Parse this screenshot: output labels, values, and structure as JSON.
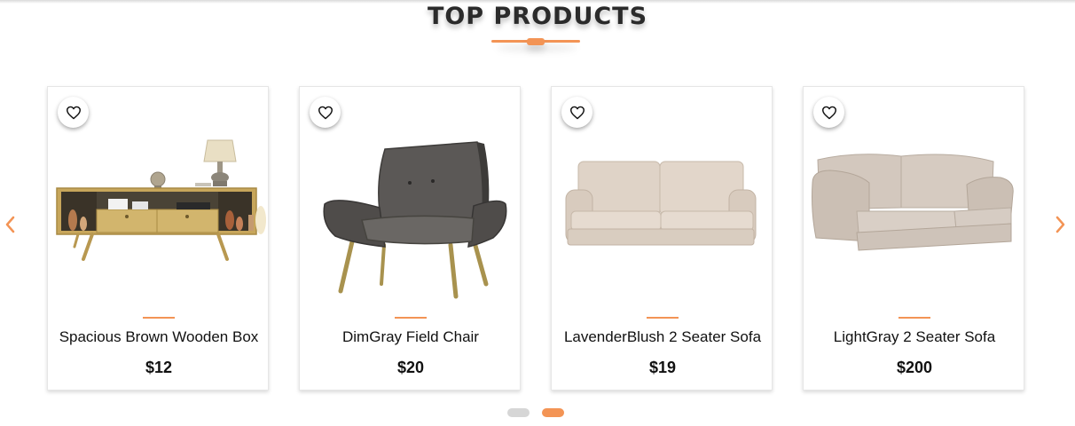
{
  "section": {
    "title": "TOP PRODUCTS"
  },
  "colors": {
    "accent": "#f39455",
    "text": "#111111",
    "inactive_dot": "#d6d6d6"
  },
  "carousel": {
    "prev_icon": "chevron-left-icon",
    "next_icon": "chevron-right-icon",
    "products": [
      {
        "name": "Spacious Brown Wooden Box",
        "price": "$12",
        "image": "tv-stand-image",
        "wishlist_icon": "heart-outline-icon"
      },
      {
        "name": "DimGray Field Chair",
        "price": "$20",
        "image": "armchair-image",
        "wishlist_icon": "heart-outline-icon"
      },
      {
        "name": "LavenderBlush 2 Seater Sofa",
        "price": "$19",
        "image": "sofa-image",
        "wishlist_icon": "heart-outline-icon"
      },
      {
        "name": "LightGray 2 Seater Sofa",
        "price": "$200",
        "image": "sofa-image",
        "wishlist_icon": "heart-outline-icon"
      }
    ],
    "pagination": {
      "pages": 2,
      "active_page": 2
    }
  }
}
